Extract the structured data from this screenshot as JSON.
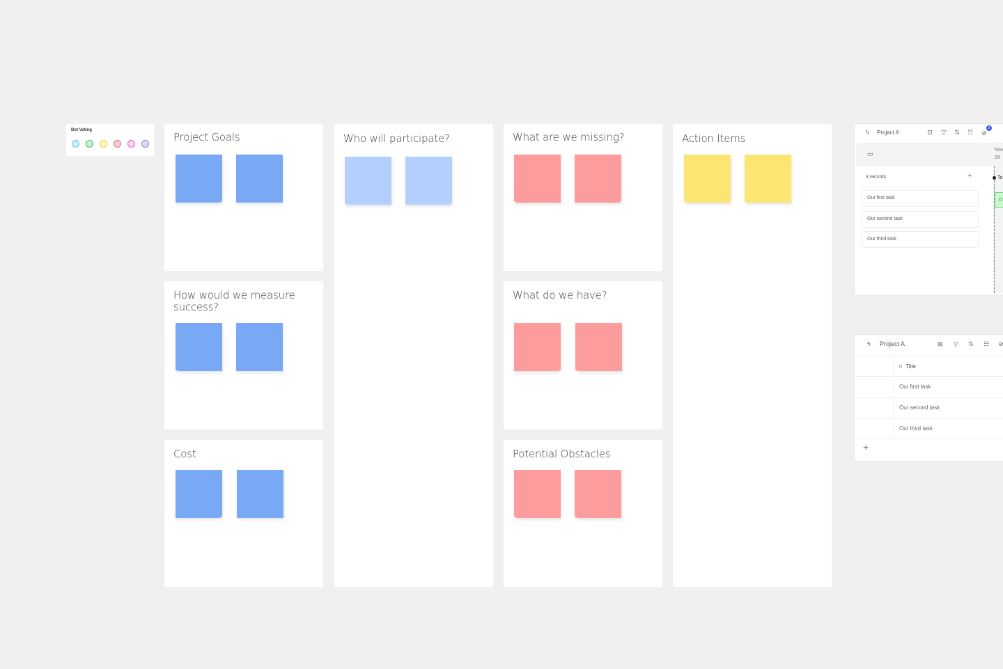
{
  "dot_voting": {
    "title": "Dot Voting",
    "dots": [
      {
        "name": "blue",
        "fill": "#c7eefc",
        "border": "#5fc7ec"
      },
      {
        "name": "green",
        "fill": "#c6f2d3",
        "border": "#3cba64"
      },
      {
        "name": "yellow",
        "fill": "#fff6b8",
        "border": "#e6cf47"
      },
      {
        "name": "red",
        "fill": "#fbcbd0",
        "border": "#e36c7b"
      },
      {
        "name": "pink",
        "fill": "#fbd0f5",
        "border": "#d66bd0"
      },
      {
        "name": "purple",
        "fill": "#e0d8fd",
        "border": "#8f7ae8"
      }
    ]
  },
  "colors": {
    "blue": "#79a9f5",
    "light_blue": "#b3cffc",
    "red": "#fd9c9c",
    "yellow": "#fde574",
    "canvas": "#f0f0f0",
    "frame": "#ffffff"
  },
  "frames": {
    "project_goals": "Project Goals",
    "measure_success": "How would we measure success?",
    "cost": "Cost",
    "participants": "Who will participate?",
    "missing": "What are we missing?",
    "have": "What do we have?",
    "obstacles": "Potential Obstacles",
    "action_items": "Action Items"
  },
  "timeline": {
    "project": "Project A",
    "records": "3 records",
    "add": "+",
    "month": "Nov",
    "day": "28",
    "today": "To",
    "bar_label": "O",
    "badge_count": "3",
    "tasks": [
      "Our first task",
      "Our second task",
      "Our third task"
    ],
    "tools": [
      "view-icon",
      "filter-icon",
      "sort-icon",
      "fields-icon",
      "hide-icon"
    ]
  },
  "table": {
    "project": "Project A",
    "column": "Title",
    "rows": [
      "Our first task",
      "Our second task",
      "Our third task"
    ],
    "add": "+"
  }
}
